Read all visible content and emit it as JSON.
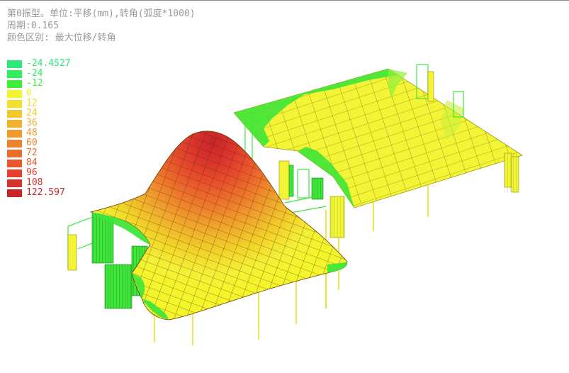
{
  "header": {
    "line1": "第0振型。单位:平移(mm),转角(弧度*1000)",
    "line2": "周期:0.165",
    "line3": "颜色区别: 最大位移/转角"
  },
  "legend": {
    "items": [
      {
        "label": "-24.4527",
        "color": "#2ee87a"
      },
      {
        "label": "-24",
        "color": "#2ef05a"
      },
      {
        "label": "-12",
        "color": "#3cf038"
      },
      {
        "label": "0",
        "color": "#f4f42c"
      },
      {
        "label": "12",
        "color": "#f2e02a"
      },
      {
        "label": "24",
        "color": "#f2c82a"
      },
      {
        "label": "36",
        "color": "#f0b22c"
      },
      {
        "label": "48",
        "color": "#f09a2c"
      },
      {
        "label": "60",
        "color": "#ee822c"
      },
      {
        "label": "72",
        "color": "#ec6c2c"
      },
      {
        "label": "84",
        "color": "#ea562c"
      },
      {
        "label": "96",
        "color": "#e4422c"
      },
      {
        "label": "108",
        "color": "#d8322c"
      },
      {
        "label": "122.597",
        "color": "#c8242a"
      }
    ]
  },
  "colors": {
    "mesh_line": "#3a3a00",
    "column": "#e8e800",
    "wall_green": "#3ee63a",
    "slab_yellow": "#f4f436"
  }
}
